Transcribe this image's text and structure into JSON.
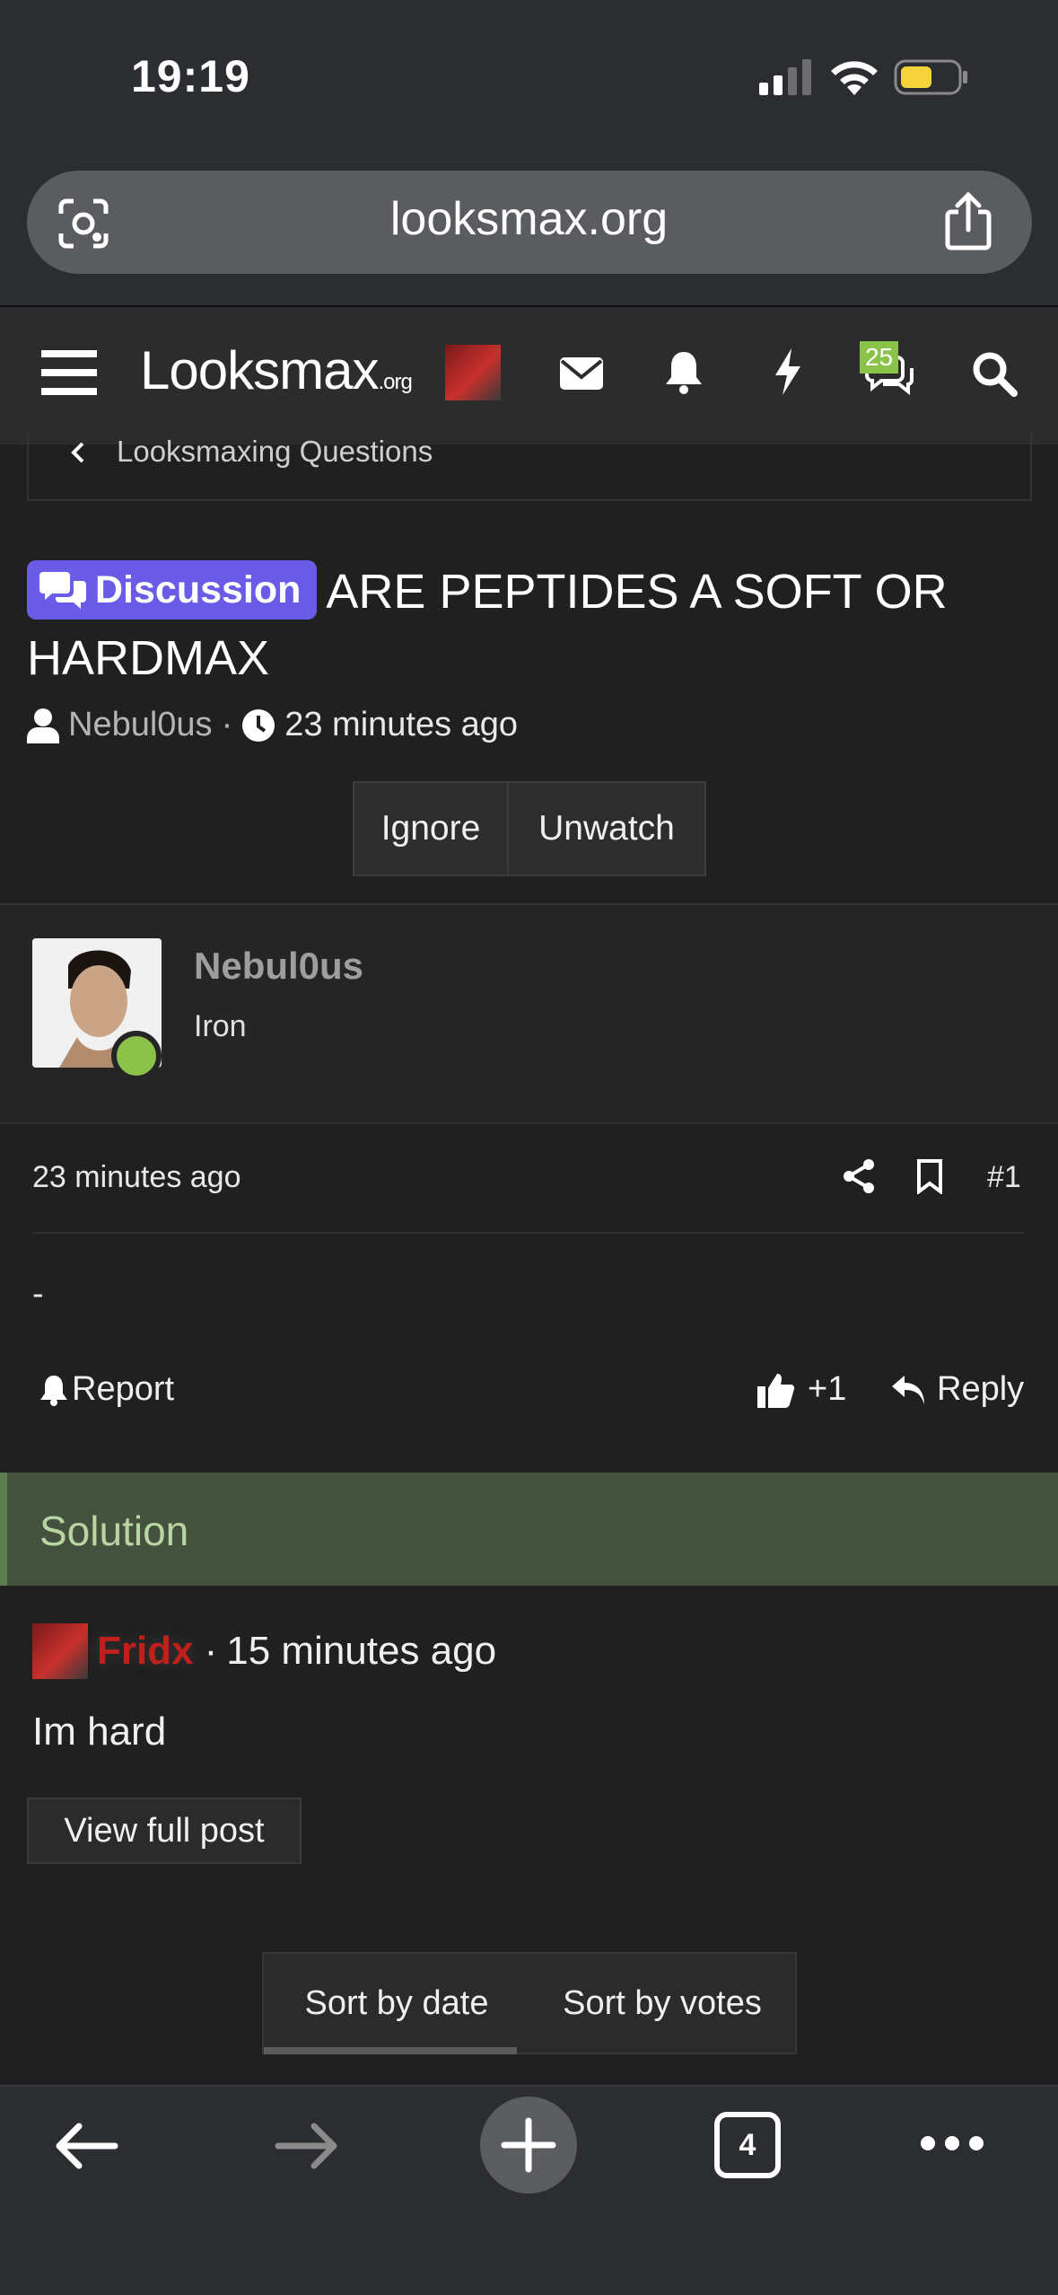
{
  "status": {
    "time": "19:19"
  },
  "browser": {
    "url": "looksmax.org",
    "tab_count": "4"
  },
  "site": {
    "logo_main": "Looksmax",
    "logo_suffix": ".org",
    "conversations_badge": "25"
  },
  "breadcrumb": {
    "label": "Looksmaxing Questions"
  },
  "thread": {
    "prefix": "Discussion",
    "title": "ARE PEPTIDES A SOFT OR HARDMAX",
    "author": "Nebul0us",
    "time": "23 minutes ago",
    "ignore_label": "Ignore",
    "unwatch_label": "Unwatch"
  },
  "post": {
    "username": "Nebul0us",
    "rank": "Iron",
    "date": "23 minutes ago",
    "number": "#1",
    "content": "-",
    "report_label": "Report",
    "like_label": "+1",
    "reply_label": "Reply"
  },
  "solution": {
    "label": "Solution",
    "author": "Fridx",
    "time": "15 minutes ago",
    "text": "Im hard",
    "view_label": "View full post"
  },
  "sort": {
    "by_date": "Sort by date",
    "by_votes": "Sort by votes",
    "active": "Sort by date"
  },
  "colors": {
    "prefix": "#6b5ce7",
    "online": "#8bc34a",
    "solution_bg": "#45513f",
    "solution_text": "#b9d6a2"
  }
}
